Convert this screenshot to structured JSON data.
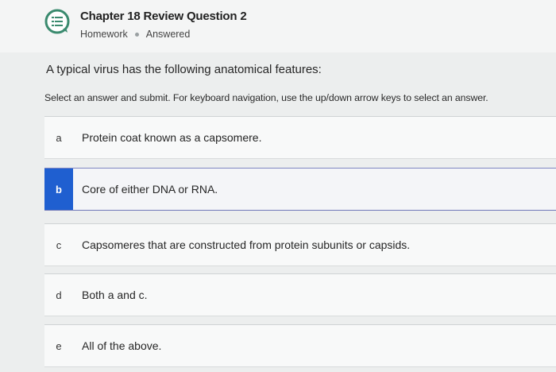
{
  "header": {
    "title": "Chapter 18 Review Question 2",
    "category": "Homework",
    "status": "Answered",
    "icon": "question-list-icon"
  },
  "question": {
    "prompt": "A typical virus has the following anatomical features:",
    "instruction": "Select an answer and submit. For keyboard navigation, use the up/down arrow keys to select an answer."
  },
  "options": [
    {
      "letter": "a",
      "text": "Protein coat known as a capsomere.",
      "selected": false
    },
    {
      "letter": "b",
      "text": "Core of either DNA or RNA.",
      "selected": true
    },
    {
      "letter": "c",
      "text": "Capsomeres that are constructed from protein subunits or capsids.",
      "selected": false
    },
    {
      "letter": "d",
      "text": "Both a and c.",
      "selected": false
    },
    {
      "letter": "e",
      "text": "All of the above.",
      "selected": false
    }
  ],
  "colors": {
    "selected_accent": "#1f5fd0",
    "icon_color": "#3a8a6e"
  }
}
